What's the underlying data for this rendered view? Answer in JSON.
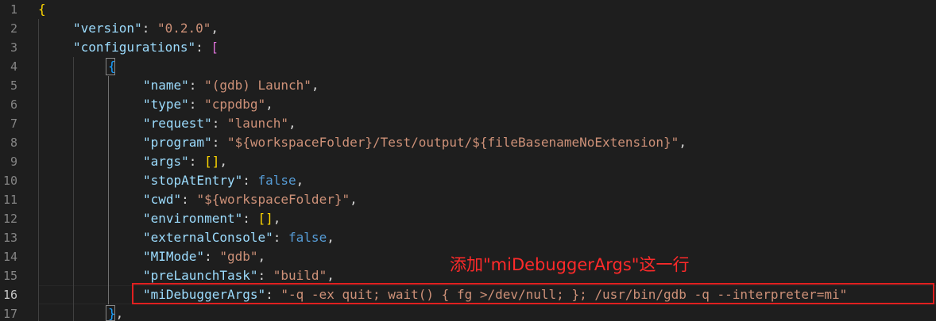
{
  "editor": {
    "line_numbers": [
      "1",
      "2",
      "3",
      "4",
      "5",
      "6",
      "7",
      "8",
      "9",
      "10",
      "11",
      "12",
      "13",
      "14",
      "15",
      "16",
      "17"
    ],
    "active_line": "16",
    "code": {
      "l1_open": "{",
      "l2_key": "\"version\"",
      "l2_val": "\"0.2.0\"",
      "l3_key": "\"configurations\"",
      "l3_open": "[",
      "l4_open": "{",
      "l5_key": "\"name\"",
      "l5_val": "\"(gdb) Launch\"",
      "l6_key": "\"type\"",
      "l6_val": "\"cppdbg\"",
      "l7_key": "\"request\"",
      "l7_val": "\"launch\"",
      "l8_key": "\"program\"",
      "l8_val": "\"${workspaceFolder}/Test/output/${fileBasenameNoExtension}\"",
      "l9_key": "\"args\"",
      "l9_val": "[]",
      "l10_key": "\"stopAtEntry\"",
      "l10_val": "false",
      "l11_key": "\"cwd\"",
      "l11_val": "\"${workspaceFolder}\"",
      "l12_key": "\"environment\"",
      "l12_val": "[]",
      "l13_key": "\"externalConsole\"",
      "l13_val": "false",
      "l14_key": "\"MIMode\"",
      "l14_val": "\"gdb\"",
      "l15_key": "\"preLaunchTask\"",
      "l15_val": "\"build\"",
      "l16_key": "\"miDebuggerArgs\"",
      "l16_val": "\"-q -ex quit; wait() { fg >/dev/null; }; /usr/bin/gdb -q --interpreter=mi\"",
      "l17_close": "}"
    }
  },
  "annotation": {
    "text": "添加\"miDebuggerArgs\"这一行"
  },
  "colors": {
    "background": "#1e1e1e",
    "key": "#9cdcfe",
    "string": "#ce9178",
    "keyword": "#569cd6",
    "annotation": "#ff2a2a"
  }
}
